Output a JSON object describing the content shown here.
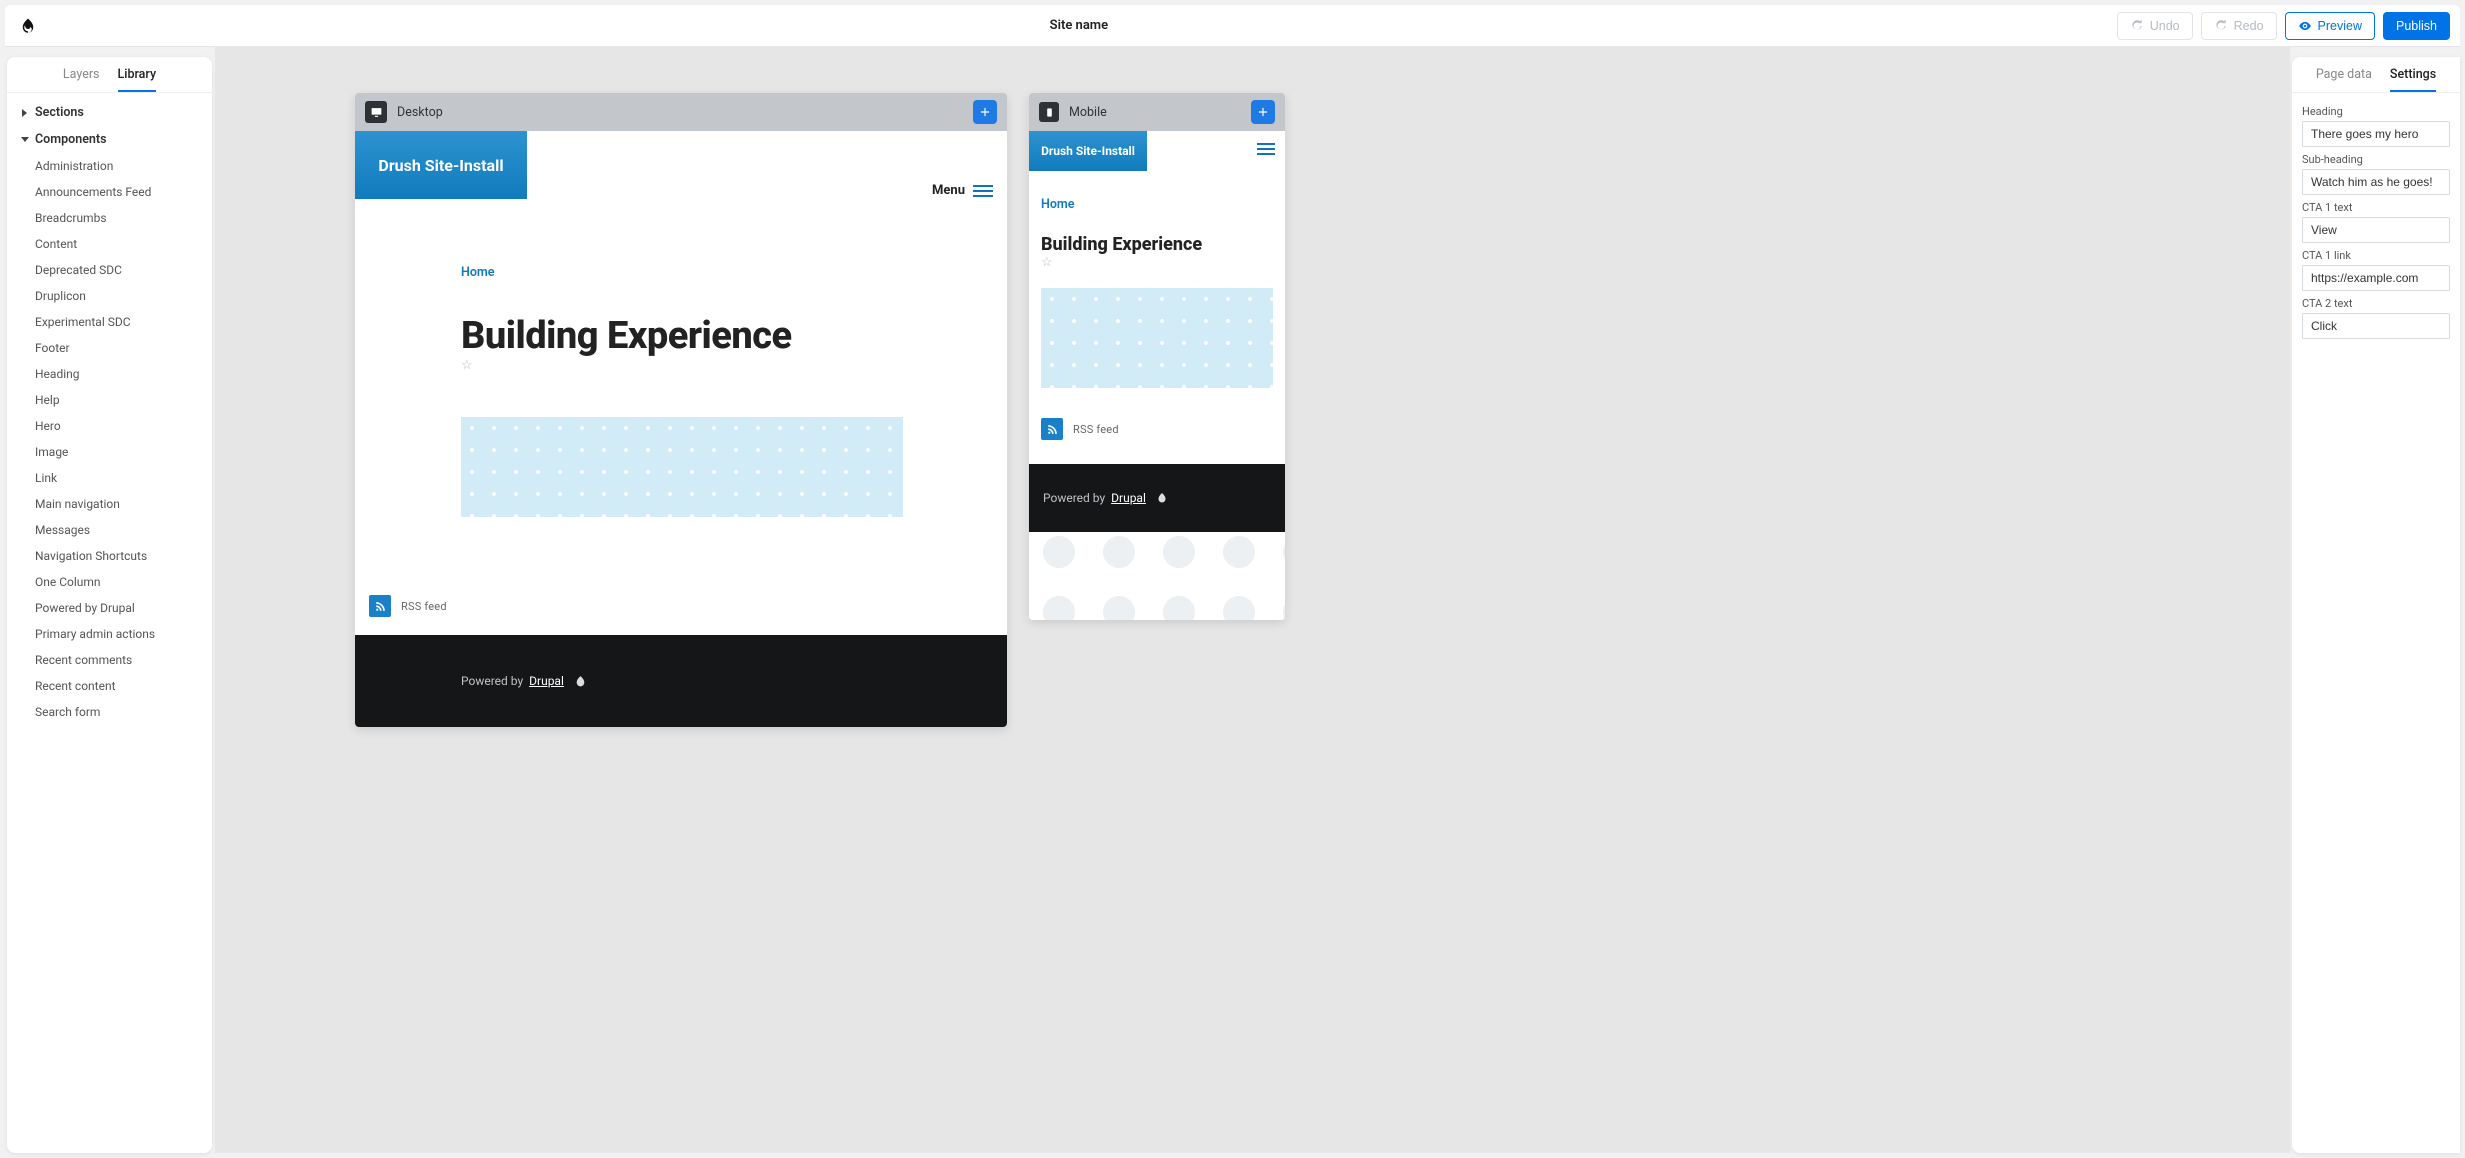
{
  "app": {
    "site_name": "Site name"
  },
  "toolbar": {
    "undo": "Undo",
    "redo": "Redo",
    "preview": "Preview",
    "publish": "Publish"
  },
  "left_panel": {
    "tabs": {
      "layers": "Layers",
      "library": "Library"
    },
    "sections_label": "Sections",
    "components_label": "Components",
    "components": [
      "Administration",
      "Announcements Feed",
      "Breadcrumbs",
      "Content",
      "Deprecated SDC",
      "Druplicon",
      "Experimental SDC",
      "Footer",
      "Heading",
      "Help",
      "Hero",
      "Image",
      "Link",
      "Main navigation",
      "Messages",
      "Navigation Shortcuts",
      "One Column",
      "Powered by Drupal",
      "Primary admin actions",
      "Recent comments",
      "Recent content",
      "Search form"
    ]
  },
  "right_panel": {
    "tabs": {
      "page_data": "Page data",
      "settings": "Settings"
    },
    "fields": {
      "heading": {
        "label": "Heading",
        "value": "There goes my hero"
      },
      "sub_heading": {
        "label": "Sub-heading",
        "value": "Watch him as he goes!"
      },
      "cta1_text": {
        "label": "CTA 1 text",
        "value": "View"
      },
      "cta1_link": {
        "label": "CTA 1 link",
        "value": "https://example.com"
      },
      "cta2_text": {
        "label": "CTA 2 text",
        "value": "Click"
      }
    }
  },
  "canvas": {
    "desktop_label": "Desktop",
    "mobile_label": "Mobile",
    "site": {
      "brand": "Drush Site-Install",
      "menu": "Menu",
      "breadcrumb": "Home",
      "title": "Building Experience",
      "rss": "RSS feed",
      "powered_by": "Powered by",
      "drupal": "Drupal"
    }
  }
}
